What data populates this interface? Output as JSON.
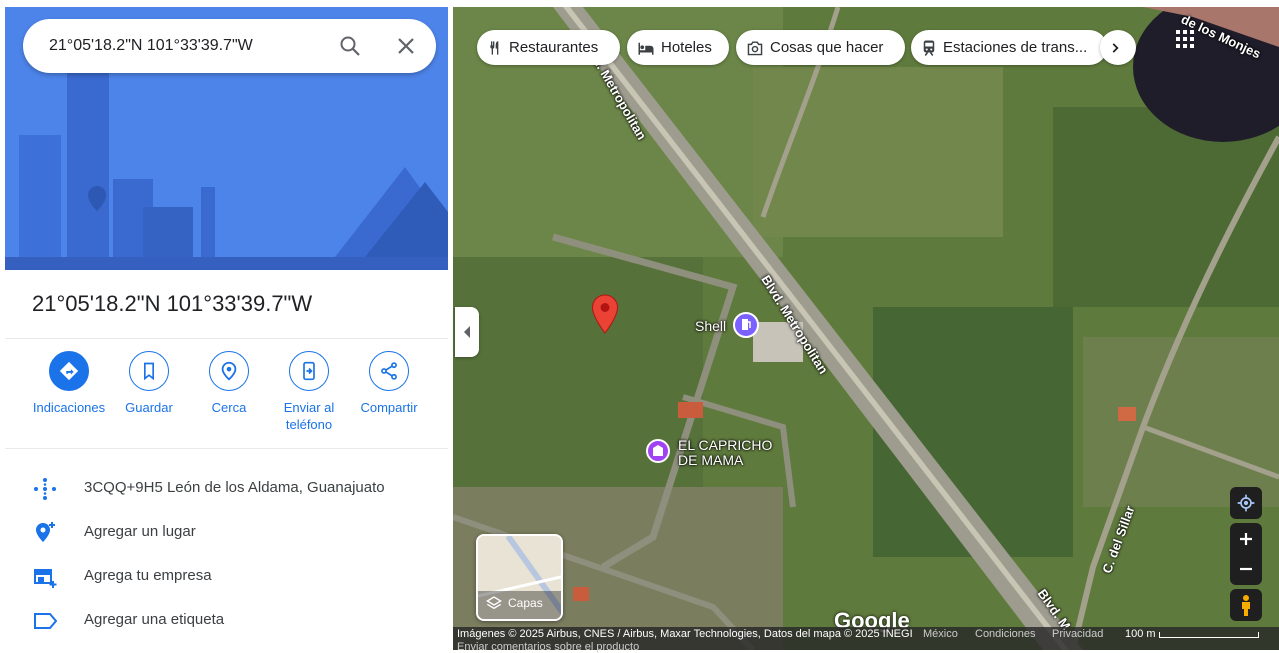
{
  "search": {
    "query": "21°05'18.2\"N 101°33'39.7\"W"
  },
  "place": {
    "title": "21°05'18.2\"N 101°33'39.7\"W"
  },
  "actions": [
    {
      "label": "Indicaciones",
      "icon": "directions-icon"
    },
    {
      "label": "Guardar",
      "icon": "bookmark-icon"
    },
    {
      "label": "Cerca",
      "icon": "nearby-icon"
    },
    {
      "label": "Enviar al teléfono",
      "icon": "send-to-phone-icon"
    },
    {
      "label": "Compartir",
      "icon": "share-icon"
    }
  ],
  "info": [
    {
      "text": "3CQQ+9H5 León de los Aldama, Guanajuato",
      "icon": "plus-code-icon"
    },
    {
      "text": "Agregar un lugar",
      "icon": "add-place-icon"
    },
    {
      "text": "Agrega tu empresa",
      "icon": "add-business-icon"
    },
    {
      "text": "Agregar una etiqueta",
      "icon": "label-icon"
    }
  ],
  "chips": [
    {
      "label": "Restaurantes",
      "icon": "fork-knife-icon"
    },
    {
      "label": "Hoteles",
      "icon": "bed-icon"
    },
    {
      "label": "Cosas que hacer",
      "icon": "camera-icon"
    },
    {
      "label": "Estaciones de trans...",
      "icon": "train-icon"
    }
  ],
  "map": {
    "roads": [
      "Blvd. Metropolitan",
      "Blvd. Metropolitan",
      "C. del Sillar",
      "de los Monjes",
      "Blvd. M"
    ],
    "poi_shell": "Shell",
    "poi_capricho": [
      "EL CAPRICHO",
      "DE MAMA"
    ],
    "layers_label": "Capas",
    "google": "Google"
  },
  "footer": {
    "imagery": "Imágenes © 2025 Airbus, CNES / Airbus, Maxar Technologies, Datos del mapa © 2025 INEGI",
    "country": "México",
    "terms": "Condiciones",
    "privacy": "Privacidad",
    "scale": "100 m",
    "feedback": "Enviar comentarios sobre el producto"
  },
  "colors": {
    "accent": "#1a73e8",
    "pin": "#ea4335",
    "poi_purple": "#a142f4"
  }
}
